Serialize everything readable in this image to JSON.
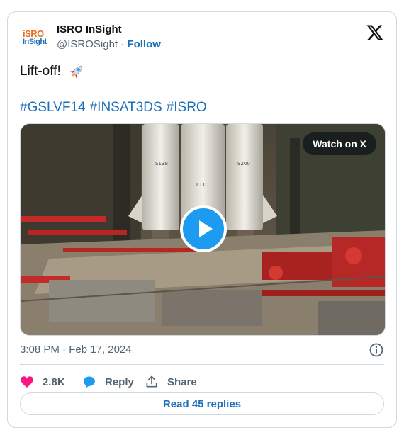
{
  "author": {
    "avatar_text_top": "iSRO",
    "avatar_text_bottom": "InSight",
    "name": "ISRO InSight",
    "handle": "@ISROSight",
    "separator": " · ",
    "follow_label": "Follow"
  },
  "post": {
    "text": "Lift-off!",
    "emoji": "rocket-emoji",
    "hashtags": [
      "#GSLVF14",
      "#INSAT3DS",
      "#ISRO"
    ]
  },
  "media": {
    "watch_label": "Watch on X",
    "play_icon": "play-icon",
    "booster_labels": [
      "S139",
      "L110",
      "S200"
    ]
  },
  "timestamp": "3:08 PM · Feb 17, 2024",
  "actions": {
    "like_count": "2.8K",
    "reply_label": "Reply",
    "share_label": "Share"
  },
  "read_replies_label": "Read 45 replies",
  "colors": {
    "link": "#1d6fb8",
    "accent_blue": "#1d9bf0",
    "like_pink": "#f91880",
    "muted": "#536471",
    "border": "#cfd9de"
  }
}
